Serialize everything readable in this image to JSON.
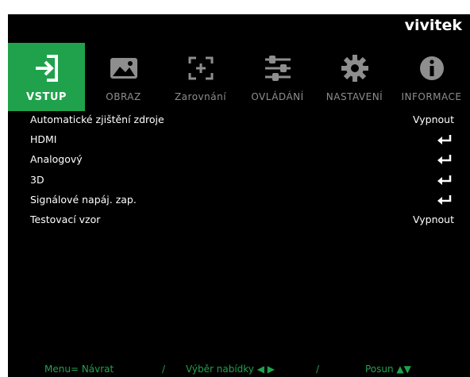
{
  "brand": {
    "logo_text": "vivitek"
  },
  "tabs": [
    {
      "label": "VSTUP",
      "icon": "input-icon",
      "active": true
    },
    {
      "label": "OBRAZ",
      "icon": "image-icon",
      "active": false
    },
    {
      "label": "Zarovnání",
      "icon": "alignment-icon",
      "active": false
    },
    {
      "label": "OVLÁDÁNÍ",
      "icon": "sliders-icon",
      "active": false
    },
    {
      "label": "NASTAVENÍ",
      "icon": "gear-icon",
      "active": false
    },
    {
      "label": "INFORMACE",
      "icon": "info-icon",
      "active": false
    }
  ],
  "menu": [
    {
      "name": "Automatické zjištění zdroje",
      "value": "Vypnout"
    },
    {
      "name": "HDMI",
      "value": "",
      "submenu": true
    },
    {
      "name": "Analogový",
      "value": "",
      "submenu": true
    },
    {
      "name": "3D",
      "value": "",
      "submenu": true
    },
    {
      "name": "Signálové napáj. zap.",
      "value": "",
      "submenu": true
    },
    {
      "name": "Testovací vzor",
      "value": "Vypnout"
    }
  ],
  "footer": {
    "back": "Menu= Návrat",
    "sep1": "/",
    "select": "Výběr nabídky ◀ ▶",
    "sep2": "/",
    "move": "Posun ▲▼"
  },
  "colors": {
    "accent": "#1fa24b",
    "background": "#000000",
    "inactive": "#8e8e8e",
    "text": "#ffffff"
  }
}
